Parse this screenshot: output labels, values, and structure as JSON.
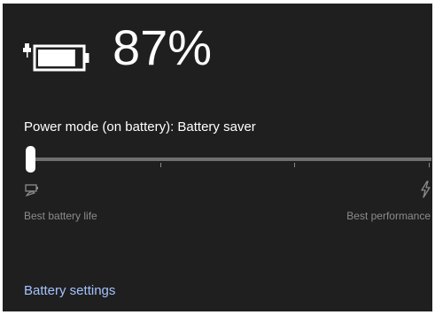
{
  "battery": {
    "percent_text": "87%",
    "level": 0.87,
    "icon": "battery-plugged-icon"
  },
  "power_mode": {
    "label": "Power mode (on battery): Battery saver",
    "slider": {
      "position": 0,
      "left_label": "Best battery life",
      "right_label": "Best performance",
      "left_icon": "battery-leaf-icon",
      "right_icon": "lightning-bolt-icon"
    }
  },
  "links": {
    "battery_settings": "Battery settings"
  },
  "colors": {
    "panel_bg": "#1f1f1f",
    "text": "#ffffff",
    "muted_text": "#8c8c8c",
    "link": "#a3c3ff",
    "track": "#6f6f6f"
  }
}
